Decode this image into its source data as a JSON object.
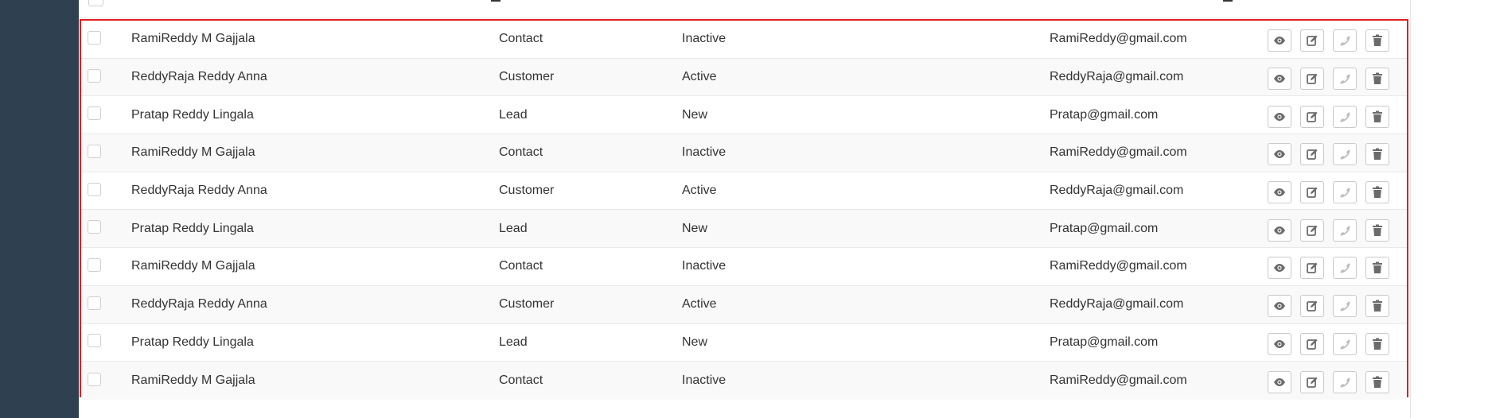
{
  "table": {
    "rows": [
      {
        "name": "RamiReddy M Gajjala",
        "category": "Contact",
        "status": "Inactive",
        "email": "RamiReddy@gmail.com"
      },
      {
        "name": "ReddyRaja Reddy Anna",
        "category": "Customer",
        "status": "Active",
        "email": "ReddyRaja@gmail.com"
      },
      {
        "name": "Pratap Reddy Lingala",
        "category": "Lead",
        "status": "New",
        "email": "Pratap@gmail.com"
      },
      {
        "name": "RamiReddy M Gajjala",
        "category": "Contact",
        "status": "Inactive",
        "email": "RamiReddy@gmail.com"
      },
      {
        "name": "ReddyRaja Reddy Anna",
        "category": "Customer",
        "status": "Active",
        "email": "ReddyRaja@gmail.com"
      },
      {
        "name": "Pratap Reddy Lingala",
        "category": "Lead",
        "status": "New",
        "email": "Pratap@gmail.com"
      },
      {
        "name": "RamiReddy M Gajjala",
        "category": "Contact",
        "status": "Inactive",
        "email": "RamiReddy@gmail.com"
      },
      {
        "name": "ReddyRaja Reddy Anna",
        "category": "Customer",
        "status": "Active",
        "email": "ReddyRaja@gmail.com"
      },
      {
        "name": "Pratap Reddy Lingala",
        "category": "Lead",
        "status": "New",
        "email": "Pratap@gmail.com"
      },
      {
        "name": "RamiReddy M Gajjala",
        "category": "Contact",
        "status": "Inactive",
        "email": "RamiReddy@gmail.com"
      }
    ],
    "row_actions": [
      "eye-icon",
      "edit-icon",
      "phone-icon",
      "trash-icon"
    ]
  },
  "colors": {
    "sidebar": "#2f4050",
    "highlight_border": "#e11d1d",
    "icon": "#6b6b6b",
    "icon_disabled": "#bdbdbd",
    "row_stripe": "#f9f9f9"
  }
}
